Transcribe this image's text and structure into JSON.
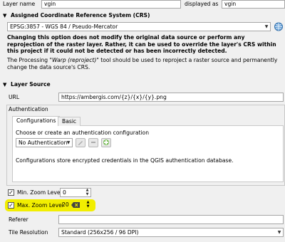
{
  "top": {
    "layer_name_label": "Layer name",
    "layer_name_value": "vgin",
    "displayed_as_label": "displayed as",
    "displayed_as_value": "vgin"
  },
  "crs_section": {
    "title": "Assigned Coordinate Reference System (CRS)",
    "crs_value": "EPSG:3857 - WGS 84 / Pseudo-Mercator",
    "warning": "Changing this option does not modify the original data source or perform any reprojection of the raster layer. Rather, it can be used to override the layer's CRS within this project if it could not be detected or has been incorrectly detected.",
    "note_prefix": "The Processing \"",
    "note_tool": "Warp (reproject)",
    "note_suffix": "\" tool should be used to reproject a raster source and permanently change the data source's CRS."
  },
  "layer_source": {
    "title": "Layer Source",
    "url_label": "URL",
    "url_value": "https://ambergis.com/{z}/{x}/{y}.png",
    "auth": {
      "title": "Authentication",
      "tabs": [
        "Configurations",
        "Basic"
      ],
      "choose_label": "Choose or create an authentication configuration",
      "auth_value": "No Authentication",
      "info": "Configurations store encrypted credentials in the QGIS authentication database."
    },
    "min_zoom_label": "Min. Zoom Level",
    "min_zoom_value": "0",
    "min_zoom_checked": true,
    "max_zoom_label": "Max. Zoom Level",
    "max_zoom_value": "20",
    "max_zoom_checked": true,
    "referer_label": "Referer",
    "referer_value": "",
    "tile_res_label": "Tile Resolution",
    "tile_res_value": "Standard (256x256 / 96 DPI)"
  },
  "colors": {
    "highlight": "#f2ee00"
  },
  "icons": {
    "expand": "triangle-down-icon",
    "crs_select": "globe-icon",
    "edit": "pencil-icon",
    "remove": "minus-icon",
    "add": "plus-icon",
    "clear": "backspace-icon"
  }
}
